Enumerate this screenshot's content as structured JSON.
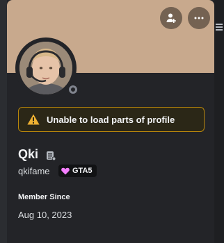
{
  "profile": {
    "display_name": "Qki",
    "username": "qkifame",
    "guild_tag": "GTA5",
    "notice_text": "Unable to load parts of profile",
    "member_since_label": "Member Since",
    "member_since_date": "Aug 10, 2023",
    "status": "offline"
  },
  "header": {
    "buttons": [
      "add-friend-icon",
      "more-options-icon"
    ]
  },
  "colors": {
    "banner": "#c8a98d",
    "card_bg": "#232428",
    "warning_border": "#b8860b",
    "warning_icon": "#f0b232",
    "tag_heart": "#f47fff"
  }
}
